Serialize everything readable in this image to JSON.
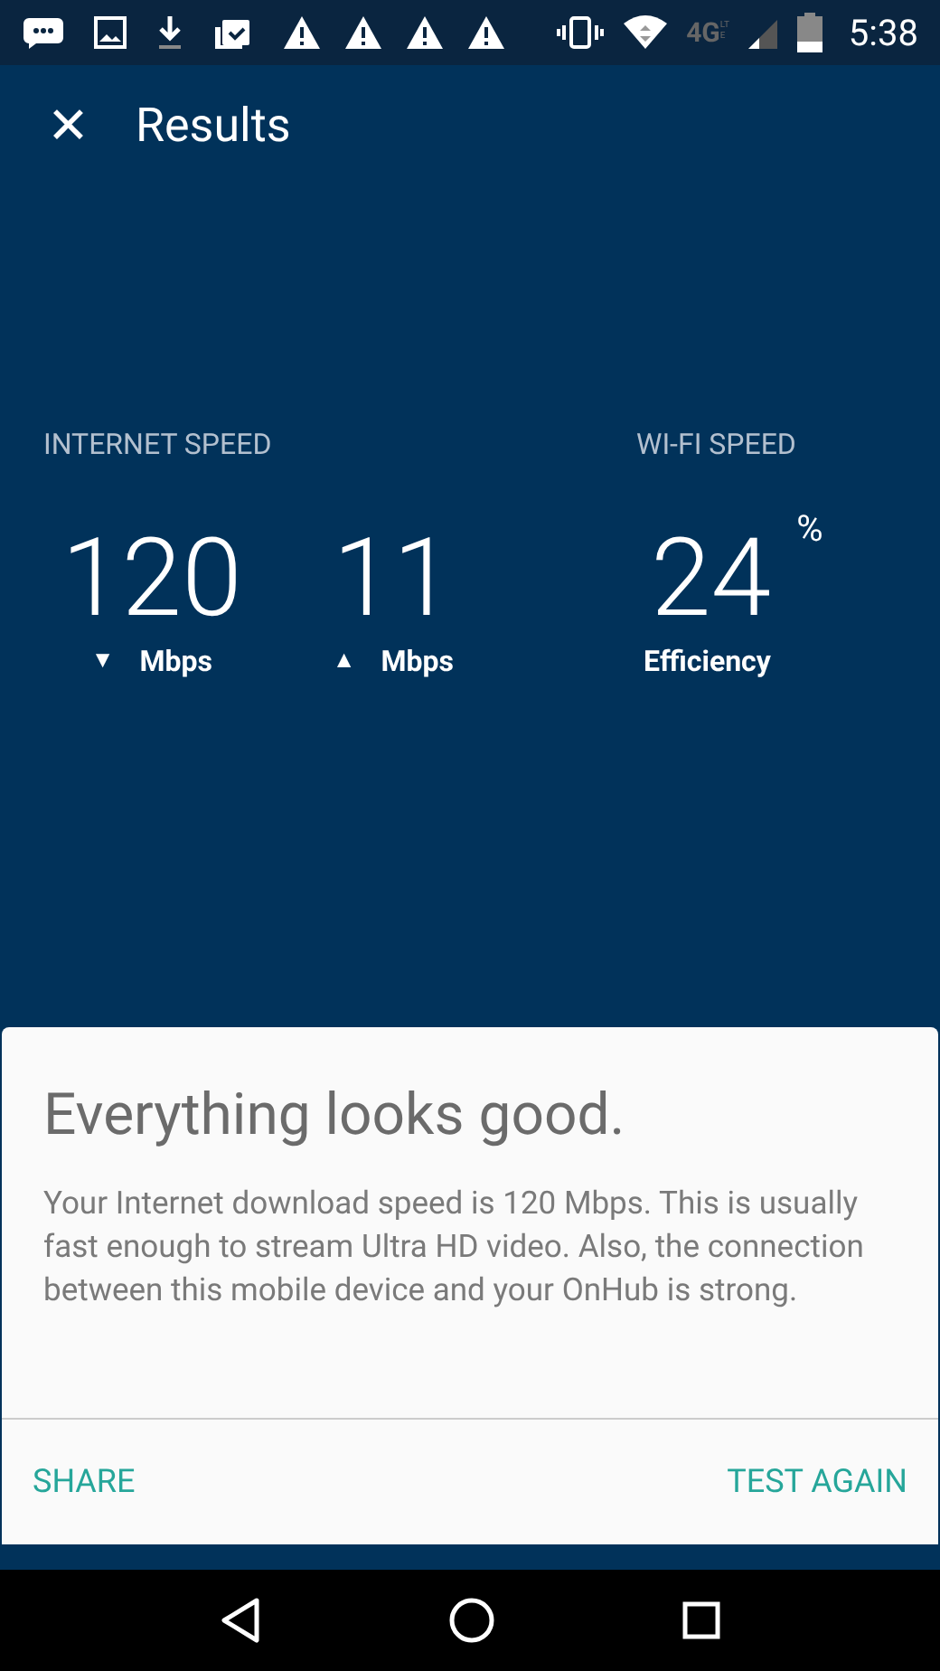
{
  "status_bar": {
    "network_type": "4G",
    "network_subtype": "LTE",
    "time": "5:38"
  },
  "toolbar": {
    "close_glyph": "✕",
    "title": "Results"
  },
  "internet_speed": {
    "label": "INTERNET SPEED",
    "metrics": [
      {
        "value": "120",
        "arrow": "▼",
        "unit": "Mbps"
      },
      {
        "value": "11",
        "arrow": "▲",
        "unit": "Mbps"
      }
    ]
  },
  "wifi_speed": {
    "label": "WI-FI SPEED",
    "value": "24",
    "suffix": "%",
    "unit": "Efficiency"
  },
  "card": {
    "title": "Everything looks good.",
    "body": "Your Internet download speed is 120 Mbps. This is usually fast enough to stream Ultra HD video. Also, the connection between this mobile device and your OnHub is strong.",
    "actions": [
      {
        "label": "SHARE"
      },
      {
        "label": "TEST AGAIN"
      }
    ]
  }
}
